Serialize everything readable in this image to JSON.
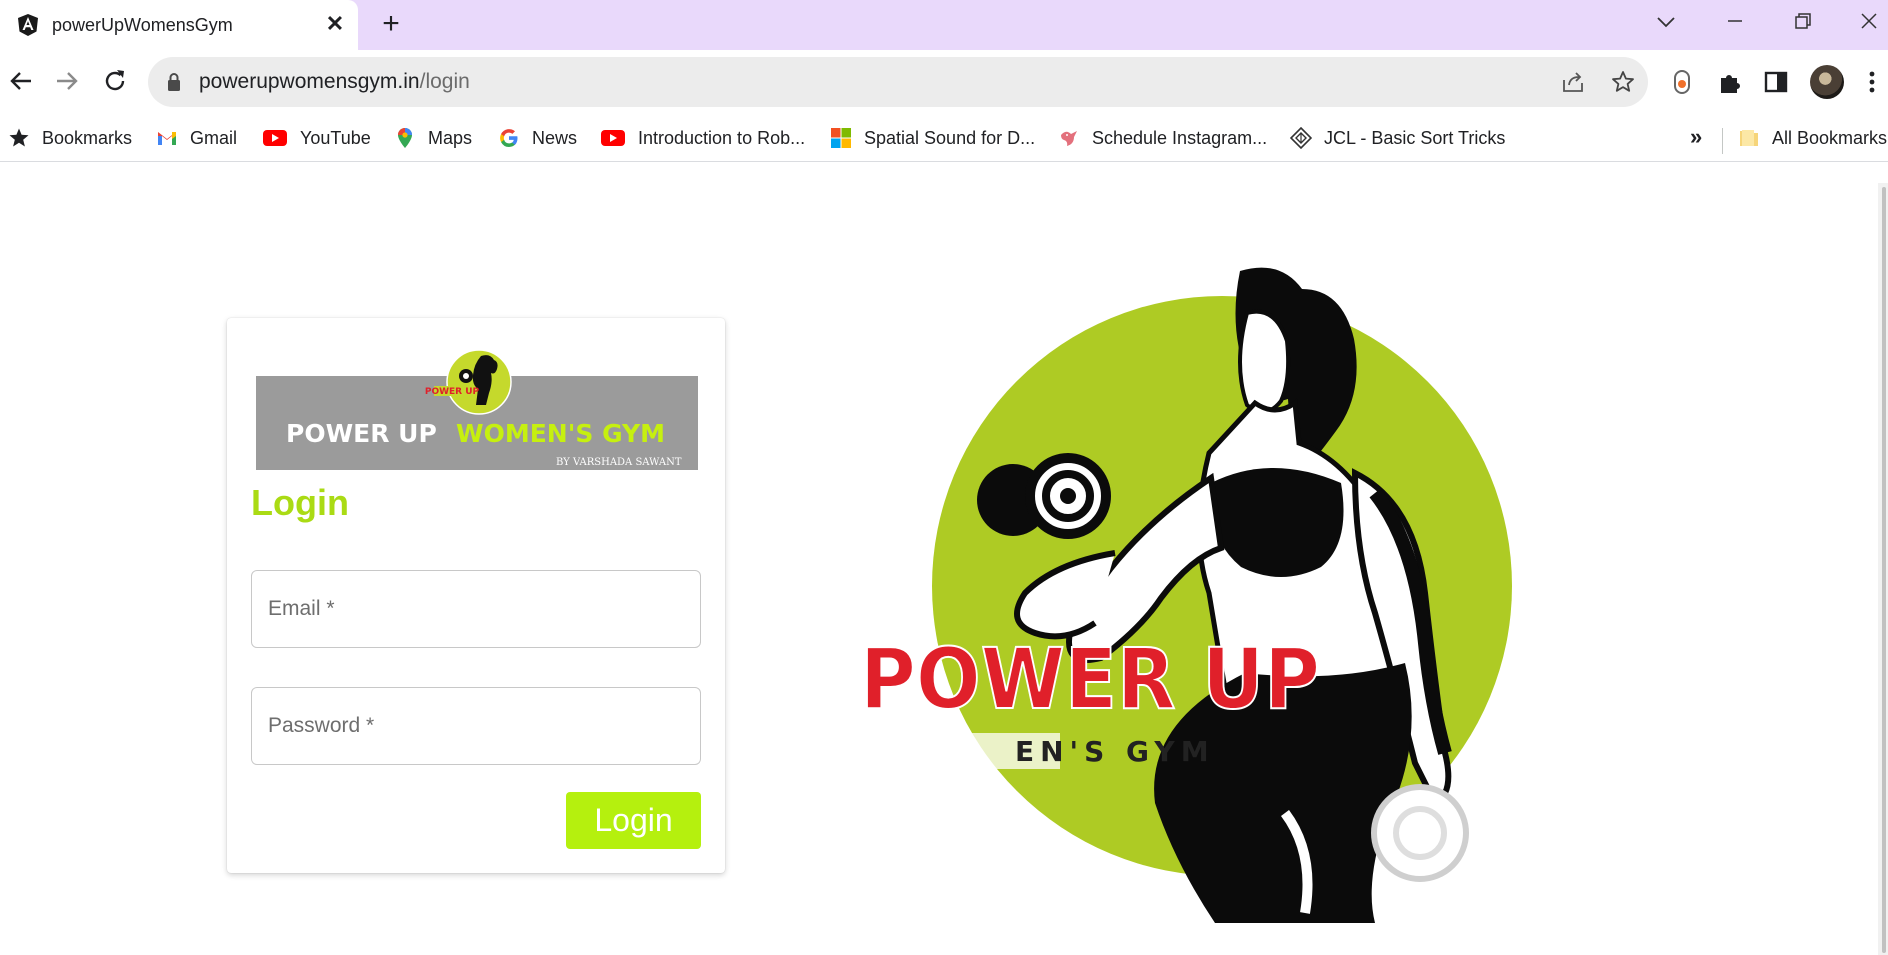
{
  "browser": {
    "tab": {
      "title": "powerUpWomensGym",
      "favicon": "angular-icon"
    },
    "url": {
      "domain": "powerupwomensgym.in",
      "path": "/login"
    },
    "bookmarks": [
      {
        "label": "Bookmarks",
        "icon": "star-icon"
      },
      {
        "label": "Gmail",
        "icon": "gmail-icon"
      },
      {
        "label": "YouTube",
        "icon": "youtube-icon"
      },
      {
        "label": "Maps",
        "icon": "maps-icon"
      },
      {
        "label": "News",
        "icon": "google-icon"
      },
      {
        "label": "Introduction to Rob...",
        "icon": "youtube-icon"
      },
      {
        "label": "Spatial Sound for D...",
        "icon": "microsoft-icon"
      },
      {
        "label": "Schedule Instagram...",
        "icon": "bird-icon"
      },
      {
        "label": "JCL - Basic Sort Tricks",
        "icon": "jcl-icon"
      }
    ],
    "bookmarks_more": "»",
    "all_bookmarks": "All Bookmarks"
  },
  "login": {
    "banner": {
      "title_white": "POWER UP",
      "title_green": "WOMEN'S GYM",
      "tagline": "BY VARSHADA SAWANT",
      "badge": "POWER UP"
    },
    "heading": "Login",
    "email_placeholder": "Email *",
    "password_placeholder": "Password *",
    "submit_label": "Login"
  },
  "hero": {
    "title": "POWER UP",
    "subtitle": "EN'S GYM"
  },
  "colors": {
    "accent_green": "#b5f00e",
    "heading_green": "#aadb14",
    "logo_circle": "#aecb24",
    "logo_red": "#e0202a",
    "tabstrip": "#e9d9fb"
  }
}
